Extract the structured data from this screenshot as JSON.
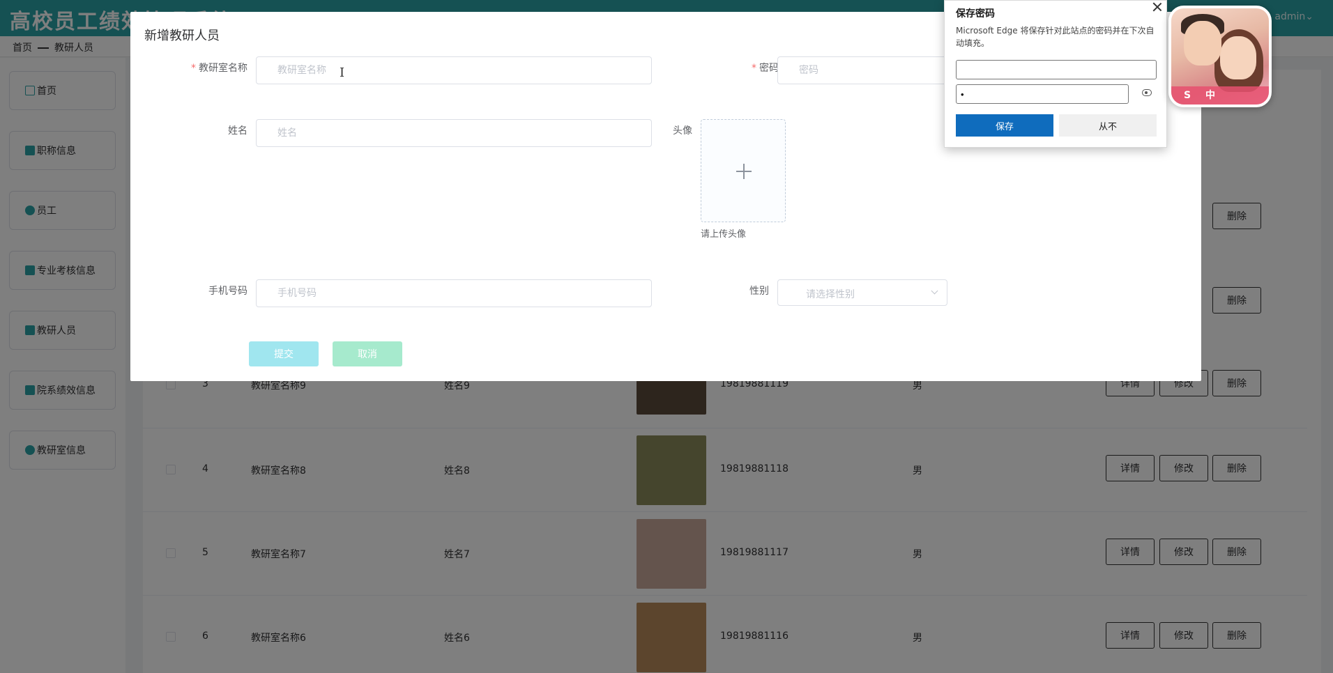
{
  "app": {
    "title": "高校员工绩效管理系统",
    "user": "admin"
  },
  "breadcrumb": {
    "home": "首页",
    "current": "教研人员"
  },
  "sidebar": {
    "items": [
      {
        "label": "首页",
        "icon": "home-icon"
      },
      {
        "label": "职称信息",
        "icon": "badge-icon"
      },
      {
        "label": "员工",
        "icon": "user-icon"
      },
      {
        "label": "专业考核信息",
        "icon": "book-icon"
      },
      {
        "label": "教研人员",
        "icon": "book-icon"
      },
      {
        "label": "院系绩效信息",
        "icon": "card-icon"
      },
      {
        "label": "教研室信息",
        "icon": "globe-icon"
      }
    ]
  },
  "table": {
    "rows": [
      {
        "index": "3",
        "room": "教研室名称9",
        "name": "姓名9",
        "phone": "19819881119",
        "gender": "男",
        "photo_color": "#5a4a3a"
      },
      {
        "index": "4",
        "room": "教研室名称8",
        "name": "姓名8",
        "phone": "19819881118",
        "gender": "男",
        "photo_color": "#8a8a5a"
      },
      {
        "index": "5",
        "room": "教研室名称7",
        "name": "姓名7",
        "phone": "19819881117",
        "gender": "男",
        "photo_color": "#c9a99a"
      },
      {
        "index": "6",
        "room": "教研室名称6",
        "name": "姓名6",
        "phone": "19819881116",
        "gender": "男",
        "photo_color": "#b88a5a"
      }
    ],
    "actions": {
      "detail": "详情",
      "edit": "修改",
      "delete": "删除"
    }
  },
  "modal": {
    "title": "新增教研人员",
    "fields": {
      "room": {
        "label": "教研室名称",
        "placeholder": "教研室名称",
        "value": ""
      },
      "password": {
        "label": "密码",
        "placeholder": "密码",
        "value": ""
      },
      "name": {
        "label": "姓名",
        "placeholder": "姓名",
        "value": ""
      },
      "avatar": {
        "label": "头像",
        "tip": "请上传头像"
      },
      "phone": {
        "label": "手机号码",
        "placeholder": "手机号码",
        "value": ""
      },
      "gender": {
        "label": "性别",
        "placeholder": "请选择性别"
      }
    },
    "submit_label": "提交",
    "cancel_label": "取消"
  },
  "password_popup": {
    "title": "保存密码",
    "description": "Microsoft Edge 将保存针对此站点的密码并在下次自动填充。",
    "username_value": "",
    "password_value": "•",
    "save_label": "保存",
    "never_label": "从不"
  },
  "floating_widget": {
    "bar_text": "S 中"
  }
}
